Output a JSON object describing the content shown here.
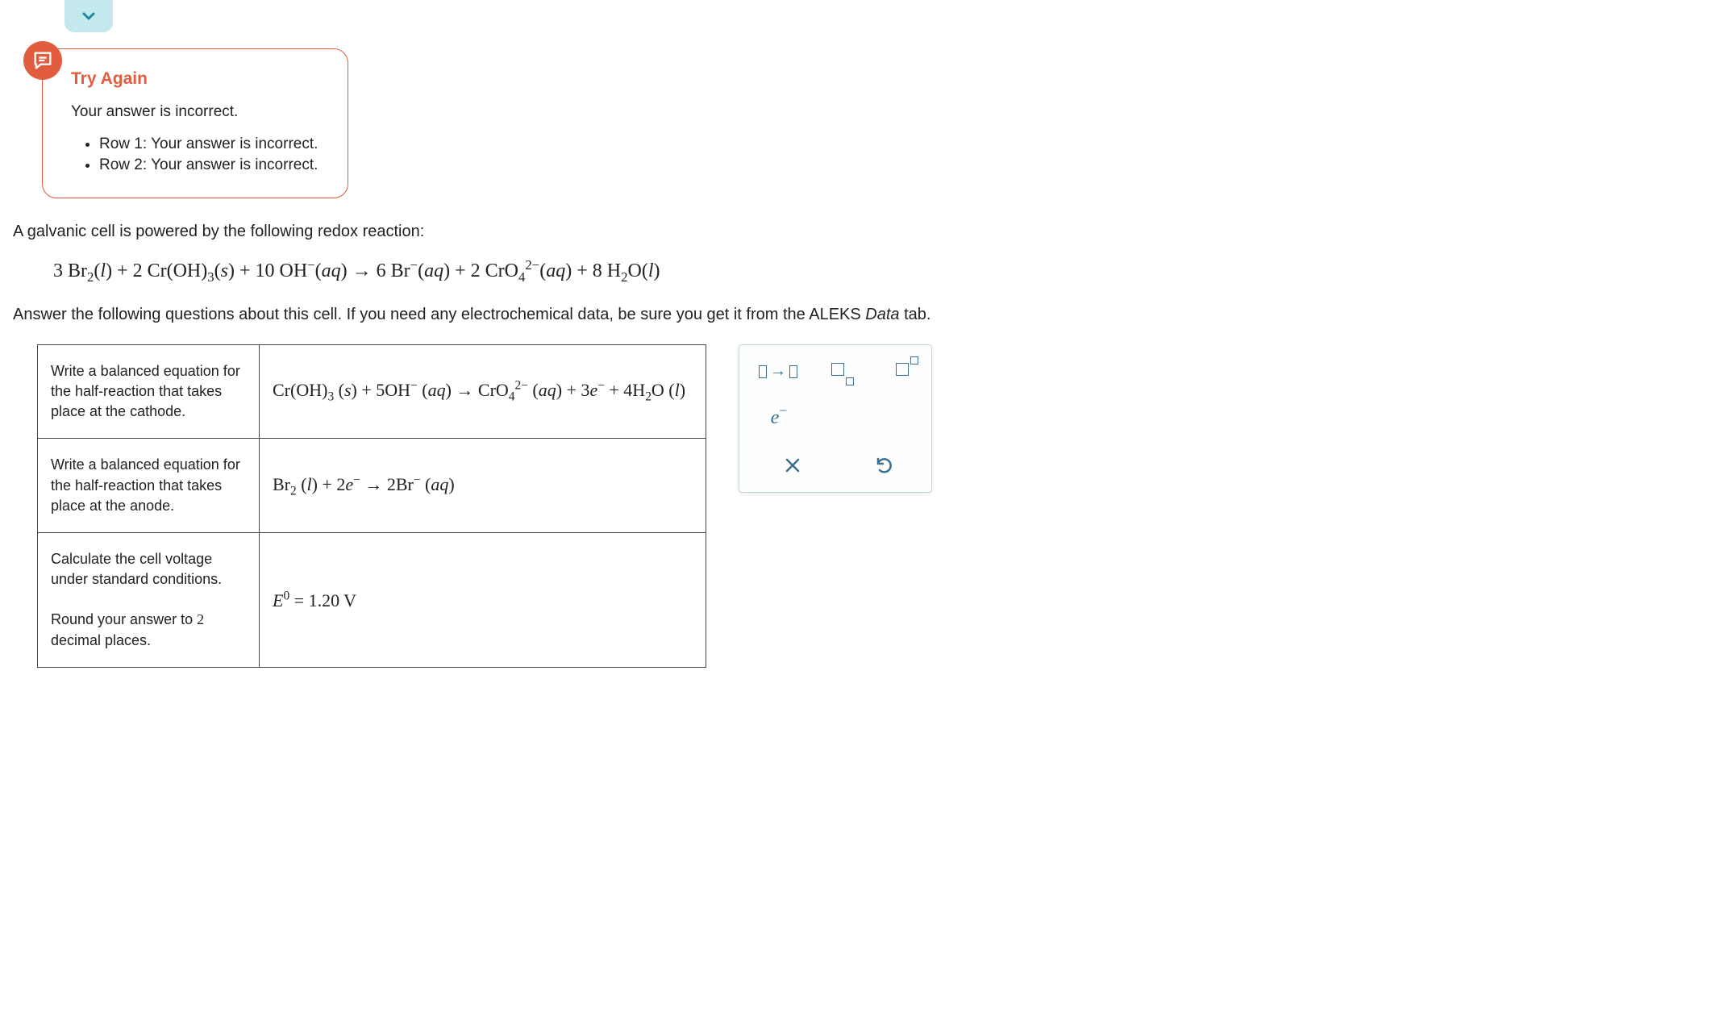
{
  "feedback": {
    "title": "Try Again",
    "summary": "Your answer is incorrect.",
    "bullets": [
      "Row 1: Your answer is incorrect.",
      "Row 2: Your answer is incorrect."
    ]
  },
  "question": {
    "intro": "A galvanic cell is powered by the following redox reaction:",
    "main_equation_html": "3 Br<sub>2</sub>(<span class='ital'>l</span>) + 2 Cr(OH)<sub>3</sub>(<span class='ital'>s</span>) + 10 OH<sup>−</sup>(<span class='ital'>aq</span>)   →   6 Br<sup>−</sup>(<span class='ital'>aq</span>) + 2 CrO<sub>4</sub><sup>2−</sup>(<span class='ital'>aq</span>) + 8 H<sub>2</sub>O(<span class='ital'>l</span>)",
    "instruction_prefix": "Answer the following questions about this cell. If you need any electrochemical data, be sure you get it from the ALEKS ",
    "instruction_link": "Data",
    "instruction_suffix": " tab."
  },
  "rows": [
    {
      "prompt": "Write a balanced equation for the half-reaction that takes place at the cathode.",
      "answer_html": "Cr(OH)<sub>3</sub> (<span class='ital'>s</span>) + 5OH<sup>−</sup> (<span class='ital'>aq</span>)   →   CrO<sub>4</sub><sup>2−</sup> (<span class='ital'>aq</span>) + 3<span class='serif ital'>e</span><sup>−</sup>  + 4H<sub>2</sub>O (<span class='ital'>l</span>)"
    },
    {
      "prompt": "Write a balanced equation for the half-reaction that takes place at the anode.",
      "answer_html": "Br<sub>2</sub> (<span class='ital'>l</span>) + 2<span class='serif ital'>e</span><sup>−</sup>   →   2Br<sup>−</sup>  (<span class='ital'>aq</span>)"
    },
    {
      "prompt_html": "Calculate the cell voltage under standard conditions.<br><br>Round your answer to <span class='serif'>2</span> decimal places.",
      "answer_html": "<span class='serif ital'>E</span><sup>0</sup>  =  1.20 V"
    }
  ],
  "toolbox": {
    "arrow_tool": "reaction-arrow",
    "subscript_tool": "subscript",
    "superscript_tool": "superscript",
    "electron_tool": "electron",
    "clear_tool": "clear",
    "undo_tool": "undo"
  }
}
